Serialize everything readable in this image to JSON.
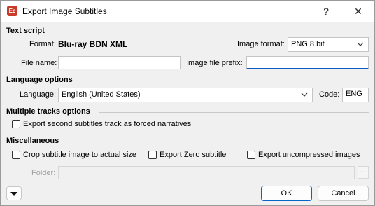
{
  "window": {
    "title": "Export Image Subtitles",
    "app_icon_text": "Ec",
    "help_label": "?",
    "close_label": "✕"
  },
  "text_script": {
    "section": "Text script",
    "format_label": "Format:",
    "format_value": "Blu-ray BDN XML",
    "image_format_label": "Image format:",
    "image_format_value": "PNG 8 bit",
    "file_name_label": "File name:",
    "file_name_value": "",
    "prefix_label": "Image file prefix:",
    "prefix_value": ""
  },
  "language": {
    "section": "Language options",
    "language_label": "Language:",
    "language_value": "English (United States)",
    "code_label": "Code:",
    "code_value": "ENG"
  },
  "tracks": {
    "section": "Multiple tracks options",
    "forced_label": "Export second subtitles track as forced narratives",
    "forced_checked": false
  },
  "misc": {
    "section": "Miscellaneous",
    "crop_label": "Crop subtitle image to actual size",
    "zero_label": "Export Zero subtitle",
    "uncompressed_label": "Export uncompressed images",
    "folder_label": "Folder:",
    "folder_value": "",
    "browse_label": "..."
  },
  "footer": {
    "ok_label": "OK",
    "cancel_label": "Cancel"
  },
  "icons": [
    "app-icon",
    "help-icon",
    "close-icon",
    "chevron-down-icon",
    "expand-icon"
  ]
}
